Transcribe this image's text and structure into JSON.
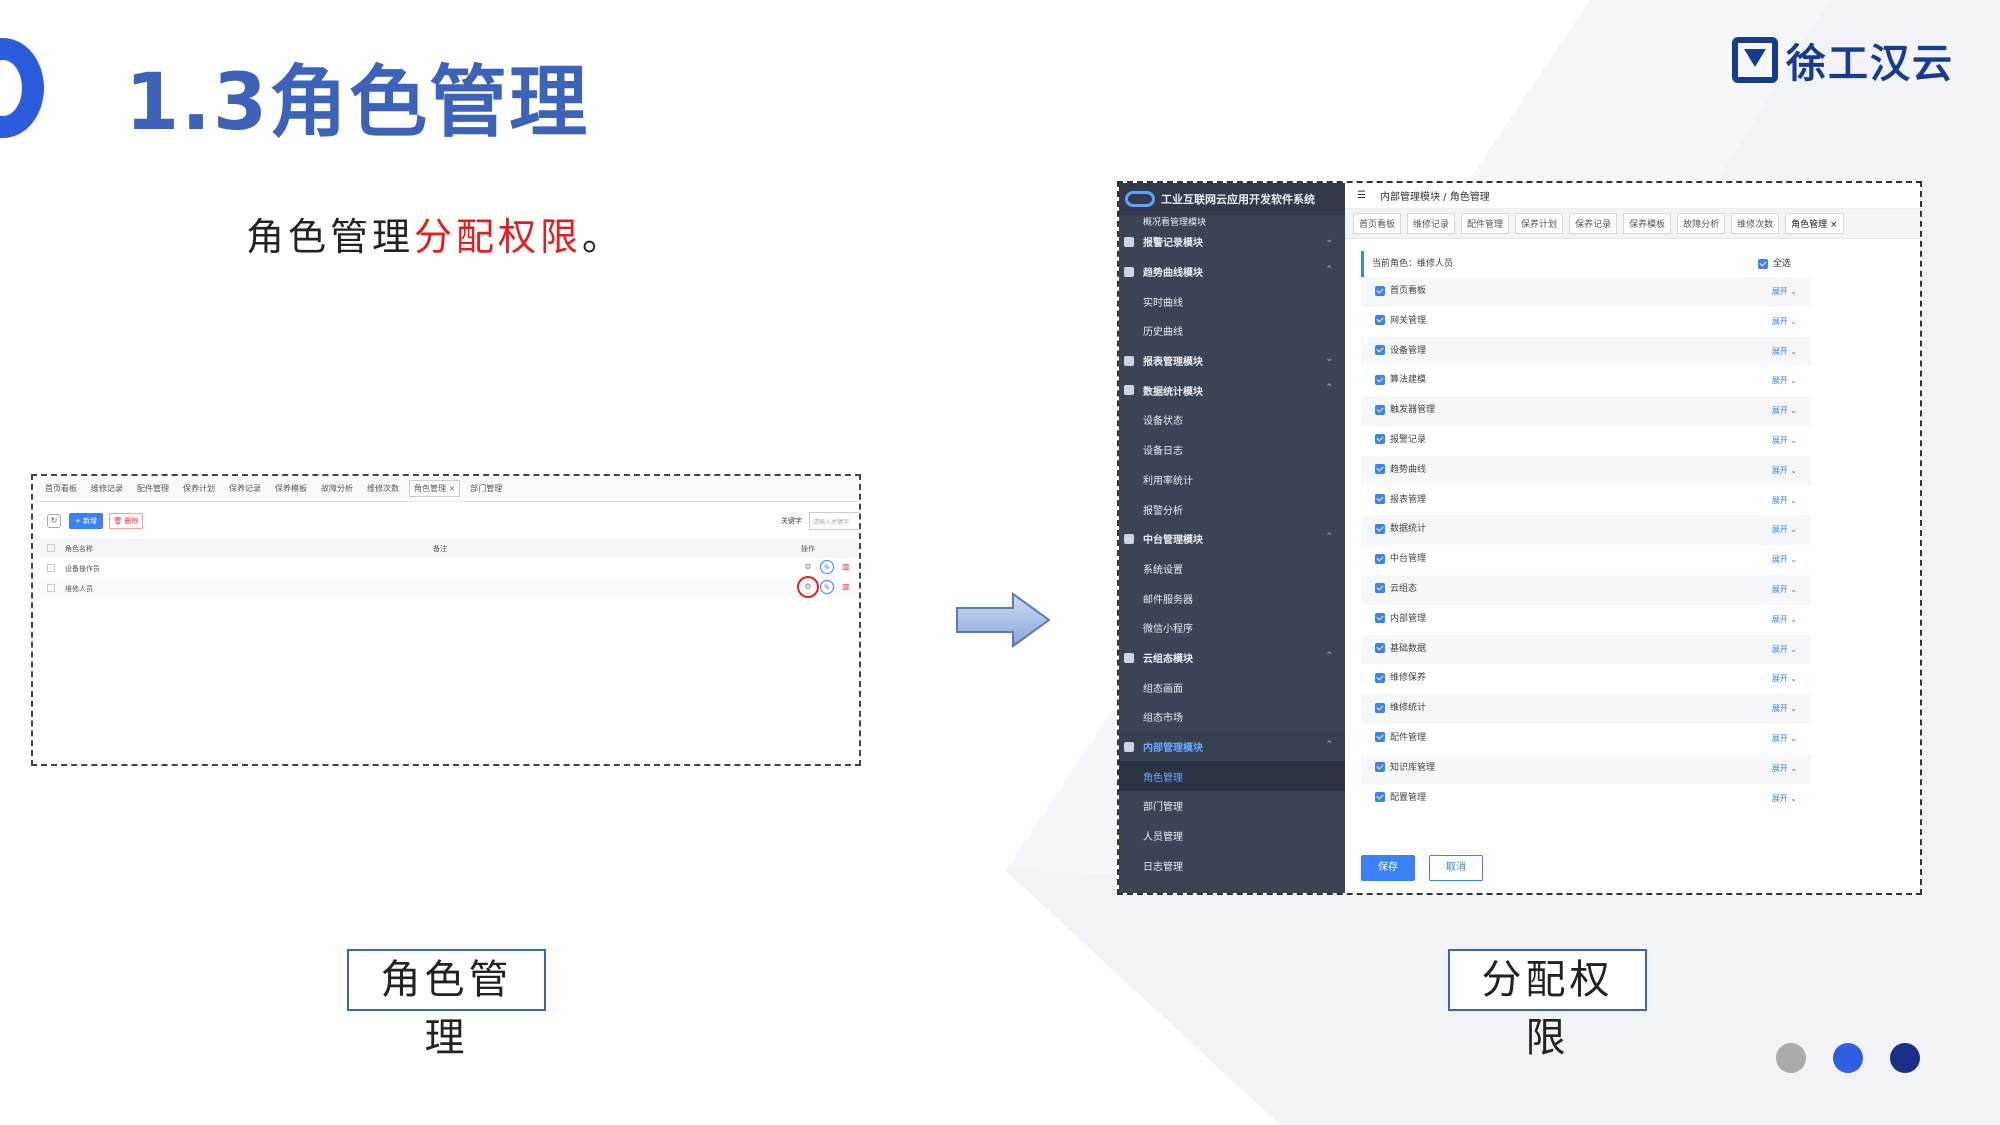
{
  "slide": {
    "title": "1.3角色管理",
    "brand": "徐工汉云",
    "subtitle_plain": "角色管理",
    "subtitle_highlight": "分配权限",
    "subtitle_end": "。",
    "caption_left": "角色管理",
    "caption_right": "分配权限",
    "colors": {
      "title": "#3d63b8",
      "highlight": "#e02020",
      "dot_gray": "#aaaaaa",
      "dot_blue": "#2f5fe0",
      "dot_navy": "#1a2f8a"
    }
  },
  "screenshot_left": {
    "tabs": [
      "首页看板",
      "维修记录",
      "配件管理",
      "保养计划",
      "保养记录",
      "保养模板",
      "故障分析",
      "维修次数",
      "角色管理 ×",
      "部门管理"
    ],
    "add_label": "+ 新增",
    "delete_label": "🗑 删除",
    "keyword_label": "关键字",
    "search_placeholder": "请输入关键字",
    "columns": [
      "角色名称",
      "备注",
      "操作"
    ],
    "rows": [
      {
        "name": "设备操作员"
      },
      {
        "name": "维修人员"
      }
    ],
    "icons": {
      "refresh": "refresh-icon",
      "gear": "gear-icon",
      "edit": "edit-icon",
      "trash": "trash-icon"
    }
  },
  "screenshot_right": {
    "app_title": "工业互联网云应用开发软件系统",
    "breadcrumb": [
      "内部管理模块",
      "角色管理"
    ],
    "menu_cut": "概况看管理模块",
    "menu": [
      {
        "label": "报警记录模块",
        "kind": "group",
        "chevron": "⌄"
      },
      {
        "label": "趋势曲线模块",
        "kind": "group",
        "chevron": "⌃"
      },
      {
        "label": "实时曲线",
        "kind": "sub"
      },
      {
        "label": "历史曲线",
        "kind": "sub"
      },
      {
        "label": "报表管理模块",
        "kind": "group",
        "chevron": "⌄"
      },
      {
        "label": "数据统计模块",
        "kind": "group",
        "chevron": "⌃"
      },
      {
        "label": "设备状态",
        "kind": "sub"
      },
      {
        "label": "设备日志",
        "kind": "sub"
      },
      {
        "label": "利用率统计",
        "kind": "sub"
      },
      {
        "label": "报警分析",
        "kind": "sub"
      },
      {
        "label": "中台管理模块",
        "kind": "group",
        "chevron": "⌃"
      },
      {
        "label": "系统设置",
        "kind": "sub"
      },
      {
        "label": "邮件服务器",
        "kind": "sub"
      },
      {
        "label": "微信小程序",
        "kind": "sub"
      },
      {
        "label": "云组态模块",
        "kind": "group",
        "chevron": "⌃"
      },
      {
        "label": "组态画面",
        "kind": "sub"
      },
      {
        "label": "组态市场",
        "kind": "sub"
      },
      {
        "label": "内部管理模块",
        "kind": "group-active",
        "chevron": "⌃"
      },
      {
        "label": "角色管理",
        "kind": "active"
      },
      {
        "label": "部门管理",
        "kind": "sub"
      },
      {
        "label": "人员管理",
        "kind": "sub"
      },
      {
        "label": "日志管理",
        "kind": "sub"
      }
    ],
    "tabs": [
      "首页看板",
      "维修记录",
      "配件管理",
      "保养计划",
      "保养记录",
      "保养模板",
      "故障分析",
      "维修次数",
      "角色管理 ×"
    ],
    "current_role": "当前角色：维修人员",
    "select_all": "全选",
    "expand_label": "展开 ⌄",
    "permissions": [
      "首页看板",
      "网关管理",
      "设备管理",
      "算法建模",
      "触发器管理",
      "报警记录",
      "趋势曲线",
      "报表管理",
      "数据统计",
      "中台管理",
      "云组态",
      "内部管理",
      "基础数据",
      "维修保养",
      "维修统计",
      "配件管理",
      "知识库管理",
      "配置管理"
    ],
    "save_label": "保存",
    "cancel_label": "取消"
  }
}
